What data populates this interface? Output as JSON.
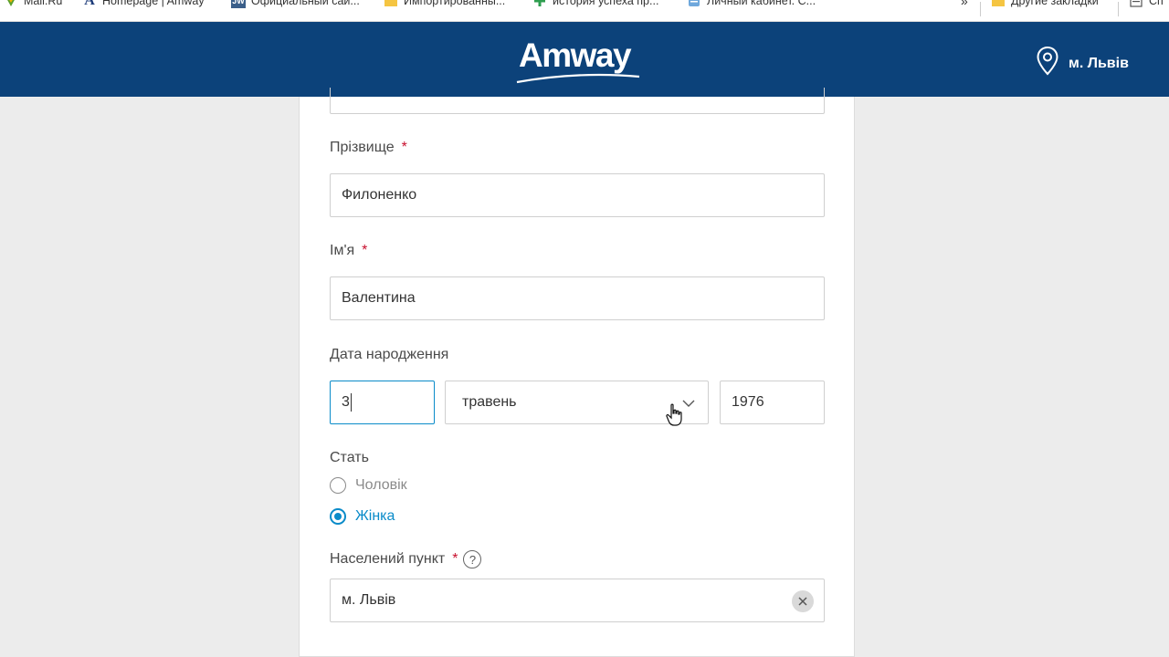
{
  "bookmarks": [
    {
      "label": "Mail.Ru",
      "icon": "mailru-icon"
    },
    {
      "label": "Homepage | Amway",
      "icon": "amway-a-icon"
    },
    {
      "label": "Официальный сай...",
      "icon": "jw-icon"
    },
    {
      "label": "Импортированны...",
      "icon": "folder-icon"
    },
    {
      "label": "история успеха пр...",
      "icon": "plus-icon"
    },
    {
      "label": "Личный кабинет. С...",
      "icon": "doc-icon"
    },
    {
      "label": "»",
      "icon": ""
    },
    {
      "label": "Другие закладки",
      "icon": "folder-icon"
    },
    {
      "label": "Сп",
      "icon": "list-icon"
    }
  ],
  "header": {
    "logo": "Amway",
    "location": "м. Львів",
    "bg_color": "#0c427a"
  },
  "form": {
    "surname_label": "Прізвище",
    "surname_value": "Филоненко",
    "name_label": "Ім'я",
    "name_value": "Валентина",
    "birth_label": "Дата народження",
    "birth_day": "3",
    "birth_month": "травень",
    "birth_year": "1976",
    "gender_label": "Стать",
    "gender_male": "Чоловік",
    "gender_female": "Жінка",
    "gender_selected": "Жінка",
    "city_label": "Населений пункт",
    "city_value": "м. Львів",
    "required_mark": "*",
    "help_mark": "?",
    "accent_color": "#0a8bc9"
  }
}
